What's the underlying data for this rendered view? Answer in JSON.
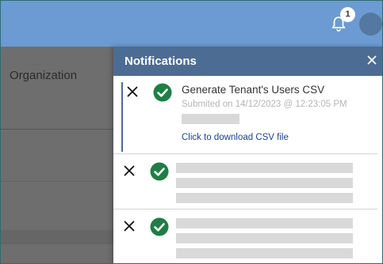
{
  "topbar": {
    "bell_icon": "bell-icon",
    "notification_count": "1",
    "avatar_color": "#5578a0",
    "color": "#6b9bd2"
  },
  "background": {
    "column_header": "Organization"
  },
  "panel": {
    "title": "Notifications",
    "close_icon": "close-icon",
    "header_color": "#4d6c93",
    "success_color": "#1e7e45",
    "items": [
      {
        "title": "Generate Tenant's Users CSV",
        "submitted": "Submited on 14/12/2023 @ 12:23:05 PM",
        "link": "Click to download CSV file",
        "status_icon": "check-circle-icon",
        "dismiss_icon": "x-icon"
      },
      {
        "status_icon": "check-circle-icon",
        "dismiss_icon": "x-icon",
        "loading": true
      },
      {
        "status_icon": "check-circle-icon",
        "dismiss_icon": "x-icon",
        "loading": true
      }
    ]
  }
}
